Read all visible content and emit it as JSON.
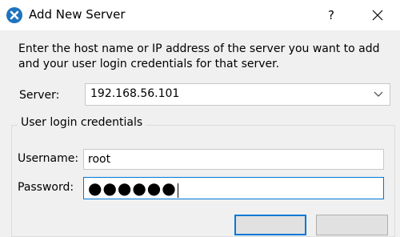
{
  "window": {
    "title": "Add New Server",
    "help_label": "?",
    "icon": "app-x-icon",
    "accent_color": "#0078d7"
  },
  "instructions": "Enter the host name or IP address of the server you want to add and your user login credentials for that server.",
  "server": {
    "label": "Server:",
    "value": "192.168.56.101"
  },
  "credentials": {
    "group_title": "User login credentials",
    "username_label": "Username:",
    "username_value": "root",
    "password_label": "Password:",
    "password_mask": "●●●●●●"
  }
}
